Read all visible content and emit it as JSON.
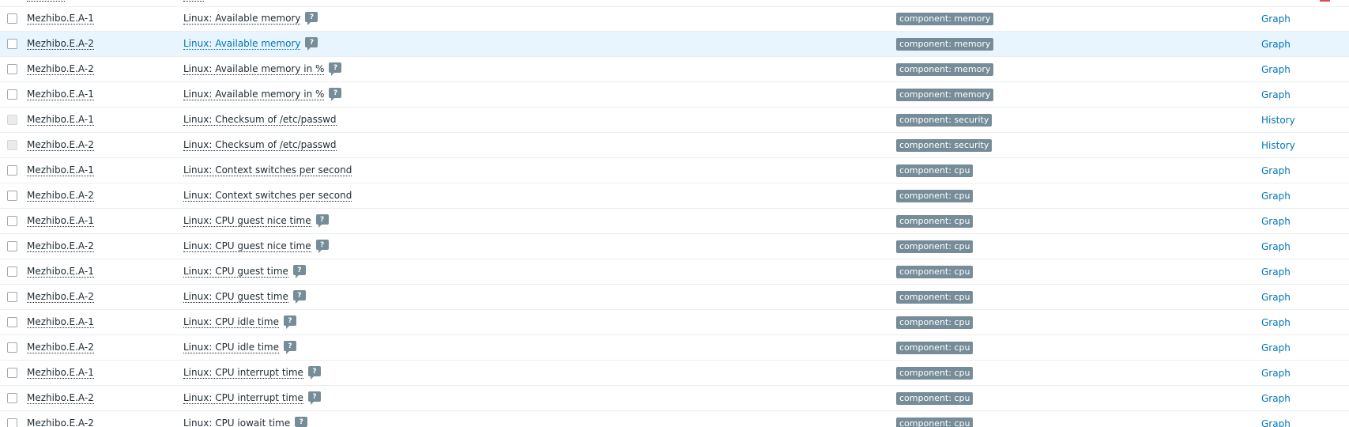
{
  "rows": [
    {
      "host": "Mezhibo.E.A-1",
      "item": "Linux: Available memory",
      "has_hint": true,
      "tag": "component: memory",
      "action": "Graph",
      "checkbox_disabled": false,
      "hover": false
    },
    {
      "host": "Mezhibo.E.A-2",
      "item": "Linux: Available memory",
      "has_hint": true,
      "tag": "component: memory",
      "action": "Graph",
      "checkbox_disabled": false,
      "hover": true
    },
    {
      "host": "Mezhibo.E.A-2",
      "item": "Linux: Available memory in %",
      "has_hint": true,
      "tag": "component: memory",
      "action": "Graph",
      "checkbox_disabled": false,
      "hover": false
    },
    {
      "host": "Mezhibo.E.A-1",
      "item": "Linux: Available memory in %",
      "has_hint": true,
      "tag": "component: memory",
      "action": "Graph",
      "checkbox_disabled": false,
      "hover": false
    },
    {
      "host": "Mezhibo.E.A-1",
      "item": "Linux: Checksum of /etc/passwd",
      "has_hint": false,
      "tag": "component: security",
      "action": "History",
      "checkbox_disabled": true,
      "hover": false
    },
    {
      "host": "Mezhibo.E.A-2",
      "item": "Linux: Checksum of /etc/passwd",
      "has_hint": false,
      "tag": "component: security",
      "action": "History",
      "checkbox_disabled": true,
      "hover": false
    },
    {
      "host": "Mezhibo.E.A-1",
      "item": "Linux: Context switches per second",
      "has_hint": false,
      "tag": "component: cpu",
      "action": "Graph",
      "checkbox_disabled": false,
      "hover": false
    },
    {
      "host": "Mezhibo.E.A-2",
      "item": "Linux: Context switches per second",
      "has_hint": false,
      "tag": "component: cpu",
      "action": "Graph",
      "checkbox_disabled": false,
      "hover": false
    },
    {
      "host": "Mezhibo.E.A-1",
      "item": "Linux: CPU guest nice time",
      "has_hint": true,
      "tag": "component: cpu",
      "action": "Graph",
      "checkbox_disabled": false,
      "hover": false
    },
    {
      "host": "Mezhibo.E.A-2",
      "item": "Linux: CPU guest nice time",
      "has_hint": true,
      "tag": "component: cpu",
      "action": "Graph",
      "checkbox_disabled": false,
      "hover": false
    },
    {
      "host": "Mezhibo.E.A-1",
      "item": "Linux: CPU guest time",
      "has_hint": true,
      "tag": "component: cpu",
      "action": "Graph",
      "checkbox_disabled": false,
      "hover": false
    },
    {
      "host": "Mezhibo.E.A-2",
      "item": "Linux: CPU guest time",
      "has_hint": true,
      "tag": "component: cpu",
      "action": "Graph",
      "checkbox_disabled": false,
      "hover": false
    },
    {
      "host": "Mezhibo.E.A-1",
      "item": "Linux: CPU idle time",
      "has_hint": true,
      "tag": "component: cpu",
      "action": "Graph",
      "checkbox_disabled": false,
      "hover": false
    },
    {
      "host": "Mezhibo.E.A-2",
      "item": "Linux: CPU idle time",
      "has_hint": true,
      "tag": "component: cpu",
      "action": "Graph",
      "checkbox_disabled": false,
      "hover": false
    },
    {
      "host": "Mezhibo.E.A-1",
      "item": "Linux: CPU interrupt time",
      "has_hint": true,
      "tag": "component: cpu",
      "action": "Graph",
      "checkbox_disabled": false,
      "hover": false
    },
    {
      "host": "Mezhibo.E.A-2",
      "item": "Linux: CPU interrupt time",
      "has_hint": true,
      "tag": "component: cpu",
      "action": "Graph",
      "checkbox_disabled": false,
      "hover": false
    },
    {
      "host": "Mezhibo.E.A-2",
      "item": "Linux: CPU iowait time",
      "has_hint": true,
      "tag": "component: cpu",
      "action": "Graph",
      "checkbox_disabled": false,
      "hover": false
    }
  ],
  "hint_glyph": "?",
  "colors": {
    "tag_bg": "#768d99",
    "link": "#0275b8",
    "hover_row": "#e8f5ff",
    "row_border": "#ebeef0"
  }
}
